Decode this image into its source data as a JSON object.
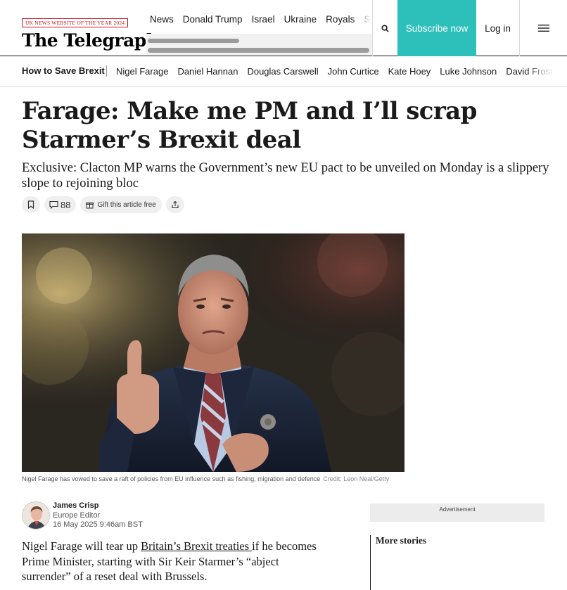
{
  "header": {
    "award": "UK NEWS WEBSITE OF THE YEAR 2024",
    "logo": "The Telegraph",
    "nav": [
      "News",
      "Donald Trump",
      "Israel",
      "Ukraine",
      "Royals",
      "Sport"
    ],
    "subscribe_label": "Subscribe now",
    "login_label": "Log in"
  },
  "topicbar": {
    "title": "How to Save Brexit",
    "links": [
      "Nigel Farage",
      "Daniel Hannan",
      "Douglas Carswell",
      "John Curtice",
      "Kate Hoey",
      "Luke Johnson",
      "David Frost"
    ]
  },
  "article": {
    "headline": "Farage: Make me PM and I’ll scrap Starmer’s Brexit deal",
    "standfirst": "Exclusive: Clacton MP warns the Government’s new EU pact to be unveiled on Monday is a slippery slope to rejoining bloc",
    "comment_count": "88",
    "gift_label": "Gift this article free",
    "caption": "Nigel Farage has vowed to save a raft of policies from EU influence such as fishing, migration and defence",
    "credit": "Credit: Leon Neal/Getty",
    "author": "James Crisp",
    "role": "Europe Editor",
    "date": "16 May 2025 9:46am BST",
    "body_start": "Nigel Farage will tear up ",
    "body_link": "Britain’s Brexit treaties ",
    "body_end": "if he becomes Prime Minister, starting with Sir Keir Starmer’s “abject surrender” of a reset deal with Brussels."
  },
  "sidebar": {
    "ad_label": "Advertisement",
    "more_title": "More stories"
  },
  "icons": {
    "search": "search-icon",
    "menu": "hamburger-menu-icon",
    "bookmark": "bookmark-icon",
    "comment": "comment-icon",
    "gift": "gift-icon",
    "share": "share-icon"
  },
  "colors": {
    "subscribe_bg": "#2dbfb9",
    "award_red": "#c4161c"
  }
}
